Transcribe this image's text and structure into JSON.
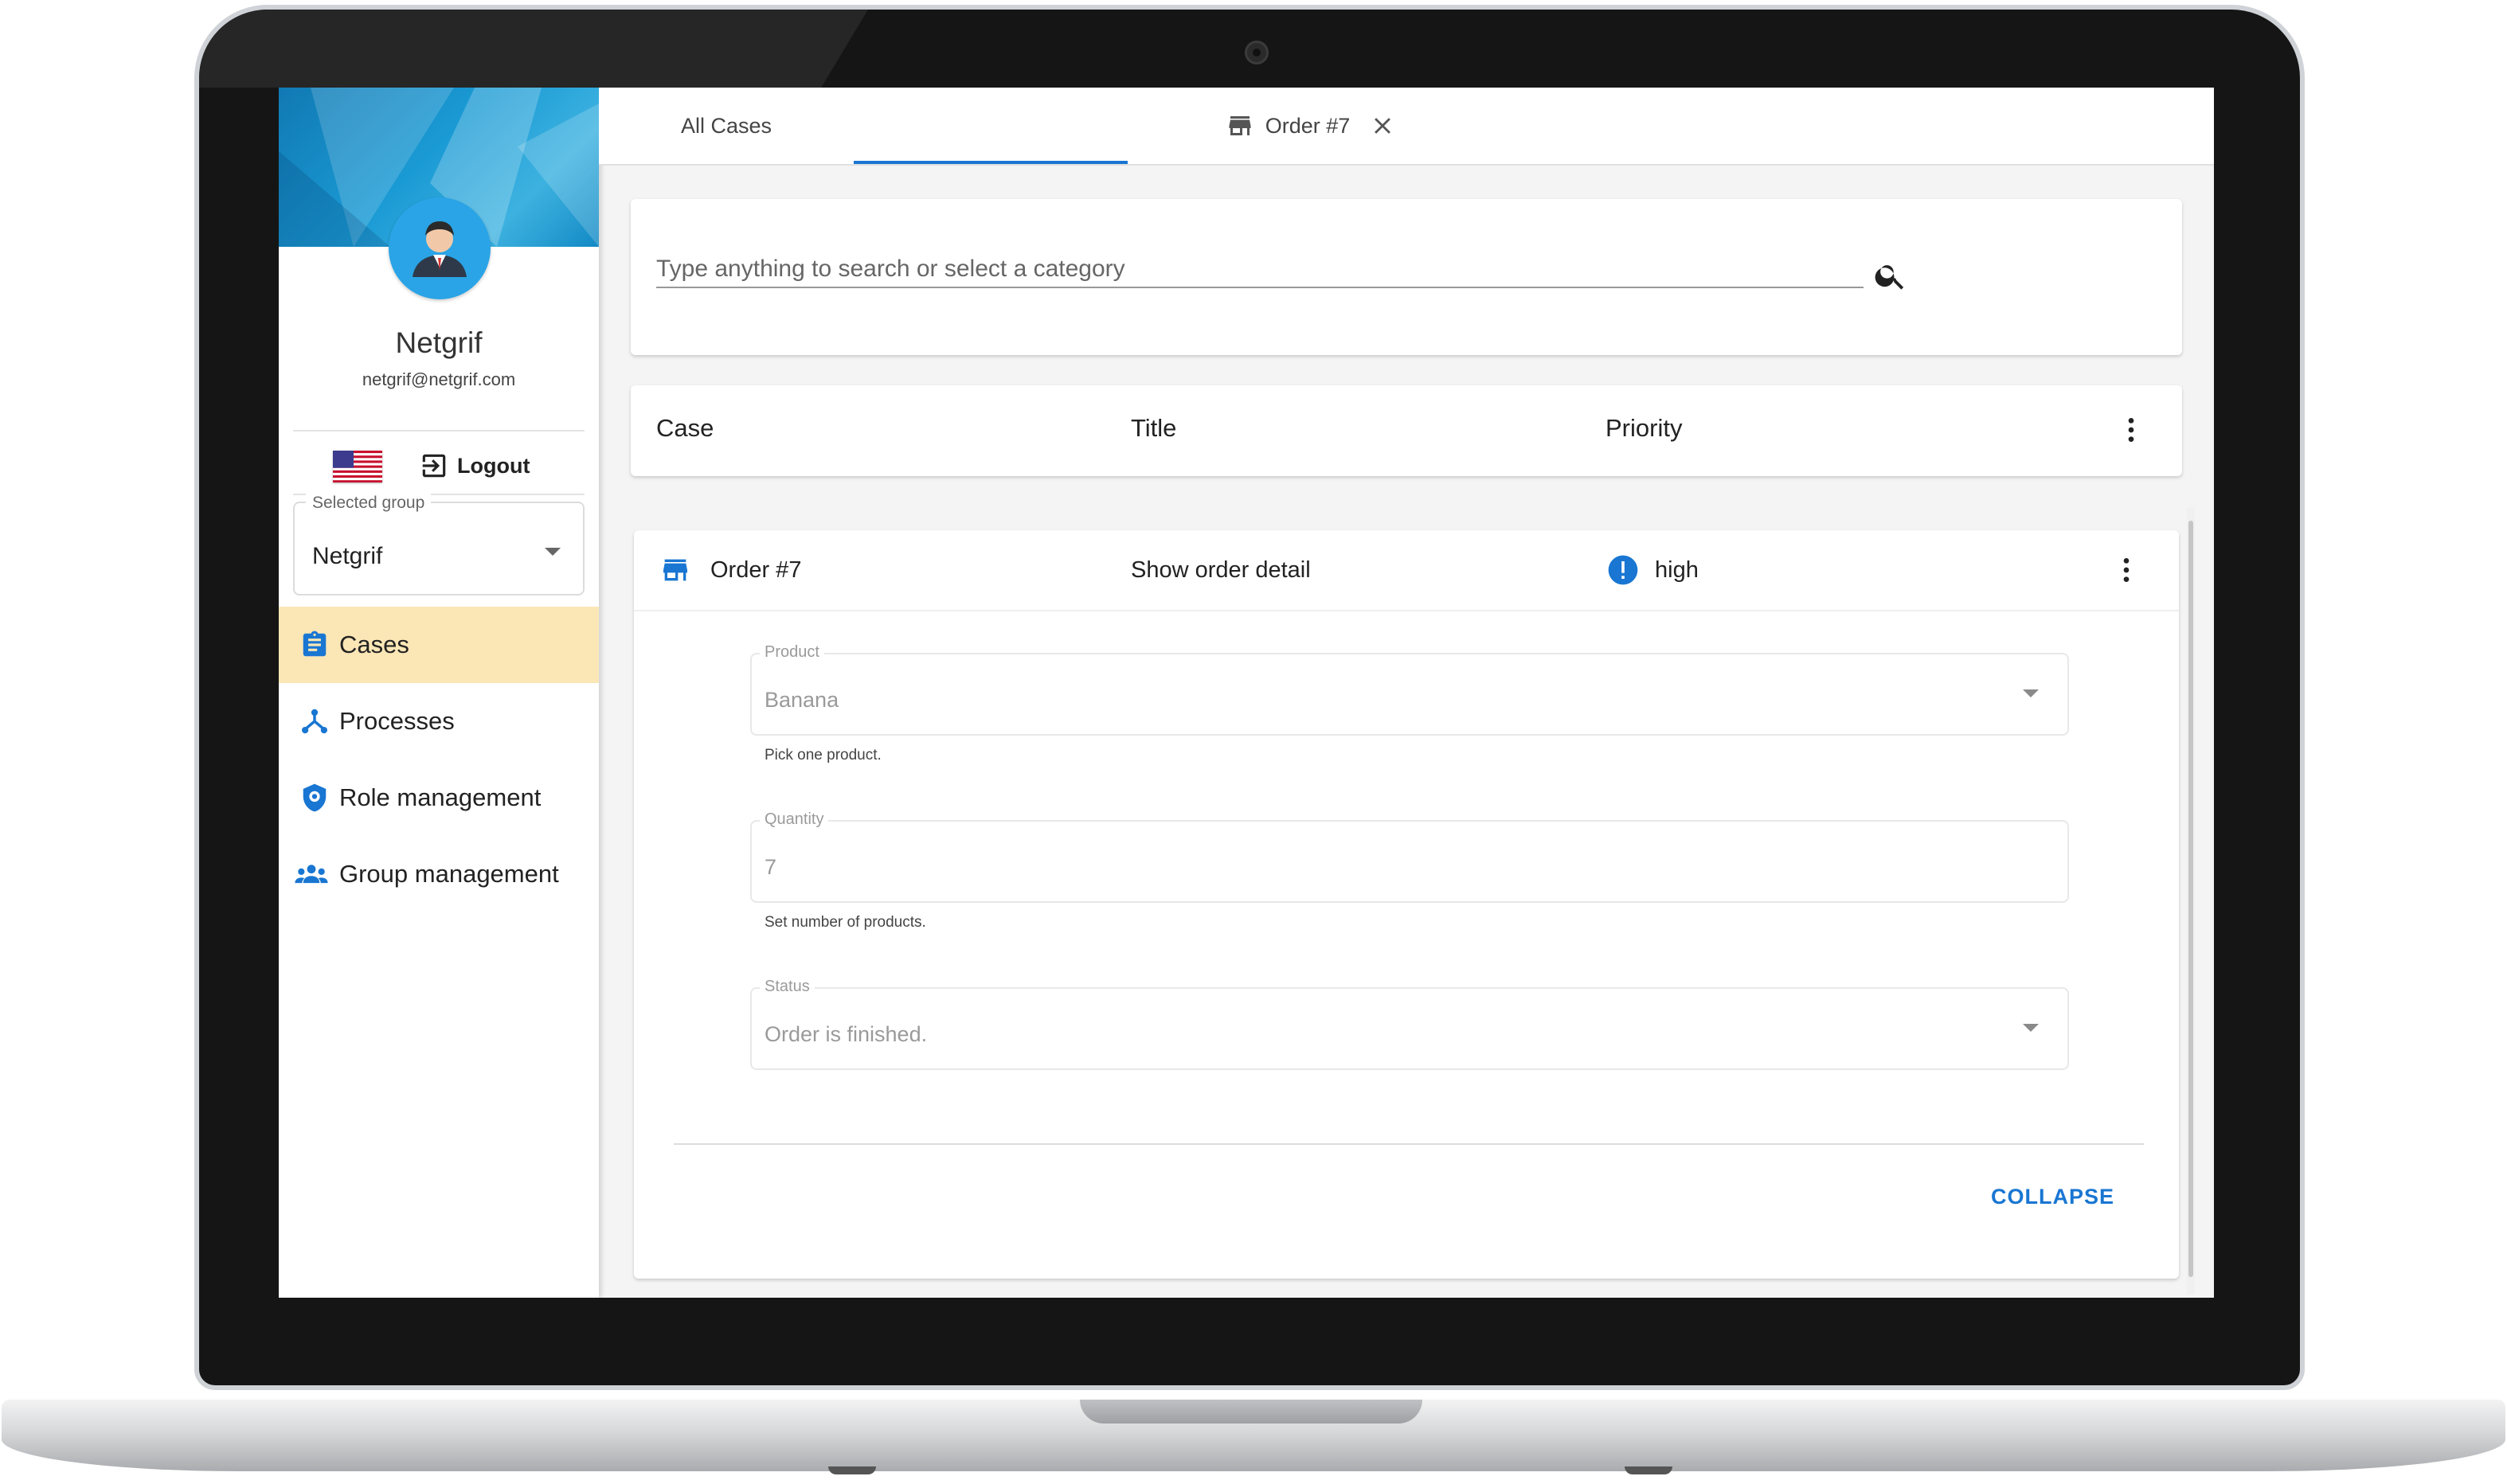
{
  "sidebar": {
    "user": {
      "name": "Netgrif",
      "email": "netgrif@netgrif.com"
    },
    "logout_label": "Logout",
    "group_select": {
      "label": "Selected group",
      "value": "Netgrif"
    },
    "nav": [
      {
        "label": "Cases",
        "icon": "clipboard-icon",
        "active": true
      },
      {
        "label": "Processes",
        "icon": "fork-icon",
        "active": false
      },
      {
        "label": "Role management",
        "icon": "shield-gear-icon",
        "active": false
      },
      {
        "label": "Group management",
        "icon": "people-icon",
        "active": false
      }
    ]
  },
  "tabs": [
    {
      "label": "All Cases",
      "active": false
    },
    {
      "label": "Order #7",
      "icon": "store-icon",
      "closable": true,
      "active": true
    }
  ],
  "search": {
    "placeholder": "Type anything to search or select a category"
  },
  "table": {
    "headers": {
      "case": "Case",
      "title": "Title",
      "priority": "Priority"
    },
    "row": {
      "case": "Order #7",
      "title": "Show order detail",
      "priority": "high",
      "form": {
        "product": {
          "label": "Product",
          "value": "Banana",
          "hint": "Pick one product."
        },
        "quantity": {
          "label": "Quantity",
          "value": "7",
          "hint": "Set number of products."
        },
        "status": {
          "label": "Status",
          "value": "Order is finished."
        }
      },
      "collapse_label": "COLLAPSE"
    }
  },
  "colors": {
    "accent": "#1976d2",
    "active_nav": "#fbe6b6",
    "banner": "#1a9ad4",
    "avatar": "#2aa4e6"
  }
}
